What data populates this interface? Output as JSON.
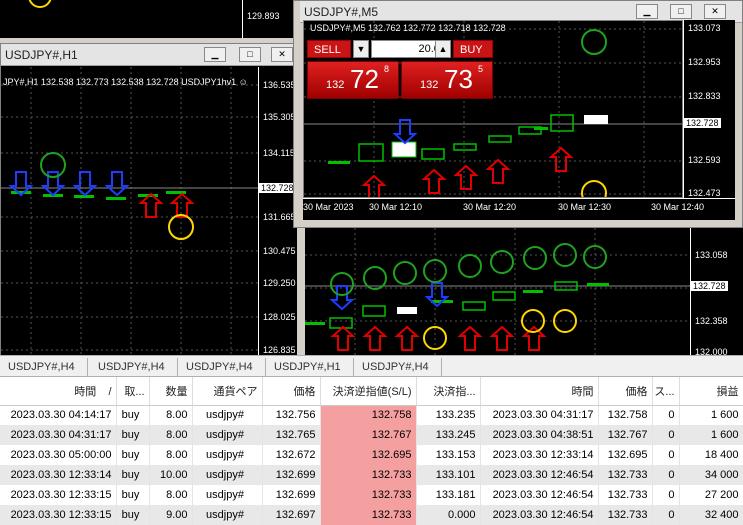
{
  "windows": {
    "h1": {
      "title": "USDJPY#,H1",
      "info": "JPY#,H1  132.538 132.773 132.538 132.728  USDJPY1hv1 ☺",
      "ticks": [
        "136.535",
        "135.305",
        "134.115",
        "131.665",
        "130.475",
        "129.250",
        "128.025",
        "126.835"
      ],
      "current": "132.728"
    },
    "m5": {
      "title": "USDJPY#,M5",
      "info": "USDJPY#,M5  132.762 132.772 132.718 132.728",
      "ticks": [
        "133.073",
        "132.953",
        "132.833",
        "132.593",
        "132.473"
      ],
      "current": "132.728",
      "xlabels": [
        "30 Mar 2023",
        "30 Mar 12:10",
        "30 Mar 12:20",
        "30 Mar 12:30",
        "30 Mar 12:40"
      ]
    },
    "bottom": {
      "ticks": [
        "133.058",
        "132.358",
        "132.000"
      ],
      "current": "132.728"
    },
    "topleft": {
      "tick": "129.893"
    }
  },
  "trade_panel": {
    "sell_label": "SELL",
    "buy_label": "BUY",
    "lot": "20.00",
    "sell_small": "132",
    "sell_big": "72",
    "sell_sup": "8",
    "buy_small": "132",
    "buy_big": "73",
    "buy_sup": "5"
  },
  "tabs": [
    "USDJPY#,H4",
    "USDJPY#,H4",
    "USDJPY#,H4",
    "USDJPY#,H1",
    "USDJPY#,H4"
  ],
  "table": {
    "headers": [
      "時間",
      "取...",
      "数量",
      "通貨ペア",
      "価格",
      "決済逆指値(S/L)",
      "決済指...",
      "時間",
      "価格",
      "ス...",
      "損益"
    ],
    "sort_mark": "/",
    "rows": [
      [
        "2023.03.30 04:14:17",
        "buy",
        "8.00",
        "usdjpy#",
        "132.756",
        "132.758",
        "133.235",
        "2023.03.30 04:31:17",
        "132.758",
        "0",
        "1 600"
      ],
      [
        "2023.03.30 04:31:17",
        "buy",
        "8.00",
        "usdjpy#",
        "132.765",
        "132.767",
        "133.245",
        "2023.03.30 04:38:51",
        "132.767",
        "0",
        "1 600"
      ],
      [
        "2023.03.30 05:00:00",
        "buy",
        "8.00",
        "usdjpy#",
        "132.672",
        "132.695",
        "133.153",
        "2023.03.30 12:33:14",
        "132.695",
        "0",
        "18 400"
      ],
      [
        "2023.03.30 12:33:14",
        "buy",
        "10.00",
        "usdjpy#",
        "132.699",
        "132.733",
        "133.101",
        "2023.03.30 12:46:54",
        "132.733",
        "0",
        "34 000"
      ],
      [
        "2023.03.30 12:33:15",
        "buy",
        "8.00",
        "usdjpy#",
        "132.699",
        "132.733",
        "133.181",
        "2023.03.30 12:46:54",
        "132.733",
        "0",
        "27 200"
      ],
      [
        "2023.03.30 12:33:15",
        "buy",
        "9.00",
        "usdjpy#",
        "132.697",
        "132.733",
        "0.000",
        "2023.03.30 12:46:54",
        "132.733",
        "0",
        "32 400"
      ]
    ]
  },
  "colors": {
    "up_arrow": "#e00000",
    "down_arrow": "#1e3cff",
    "smiley_green": "#1fa31f",
    "smiley_yellow": "#ffd800",
    "candle": "#00c000"
  }
}
